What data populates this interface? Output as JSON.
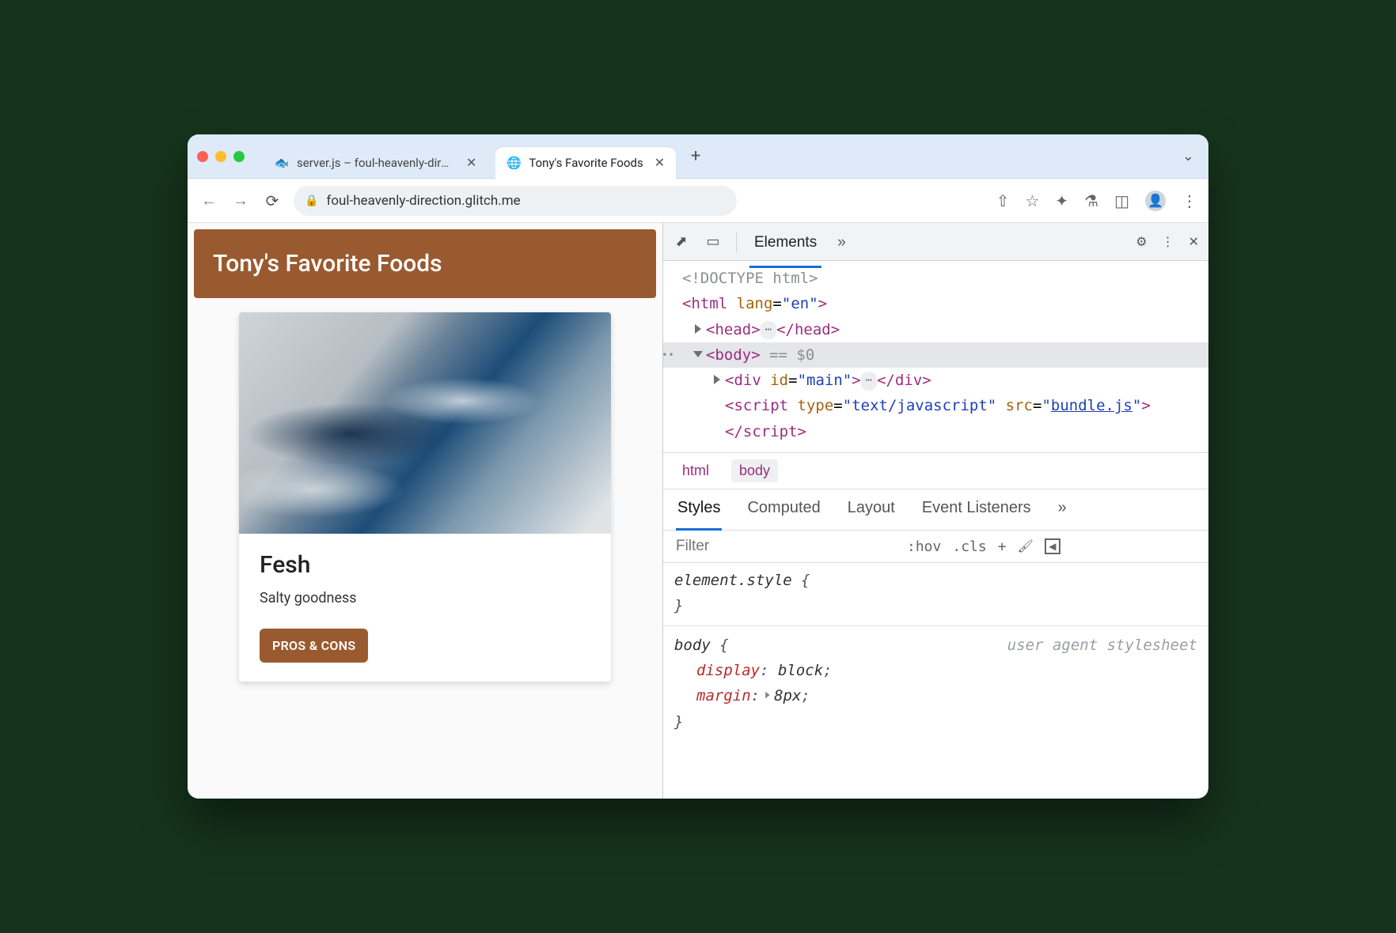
{
  "browser": {
    "tabs": [
      {
        "title": "server.js – foul-heavenly-direct",
        "active": false
      },
      {
        "title": "Tony's Favorite Foods",
        "active": true
      }
    ],
    "url": "foul-heavenly-direction.glitch.me"
  },
  "page": {
    "header": "Tony's Favorite Foods",
    "card": {
      "title": "Fesh",
      "description": "Salty goodness",
      "button": "PROS & CONS",
      "image_alt": "fish"
    }
  },
  "devtools": {
    "main_tabs": {
      "active": "Elements",
      "more": "»"
    },
    "dom": {
      "doctype": "<!DOCTYPE html>",
      "html_open": "<html lang=\"en\">",
      "head": "<head>…</head>",
      "body_open": "<body>",
      "body_marker": "== $0",
      "div_line": "<div id=\"main\">…</div>",
      "script_line_prefix": "<script type=\"text/javascript\" src=\"",
      "script_src": "bundle.js",
      "script_line_suffix": "\"></script>"
    },
    "breadcrumbs": [
      "html",
      "body"
    ],
    "sub_tabs": [
      "Styles",
      "Computed",
      "Layout",
      "Event Listeners"
    ],
    "filter_placeholder": "Filter",
    "filter_tools": {
      "hov": ":hov",
      "cls": ".cls",
      "plus": "+"
    },
    "styles": {
      "block1": {
        "selector": "element.style",
        "rules": []
      },
      "block2": {
        "selector": "body",
        "source": "user agent stylesheet",
        "rules": [
          {
            "prop": "display",
            "val": "block"
          },
          {
            "prop": "margin",
            "val": "8px",
            "expandable": true
          }
        ]
      }
    }
  }
}
